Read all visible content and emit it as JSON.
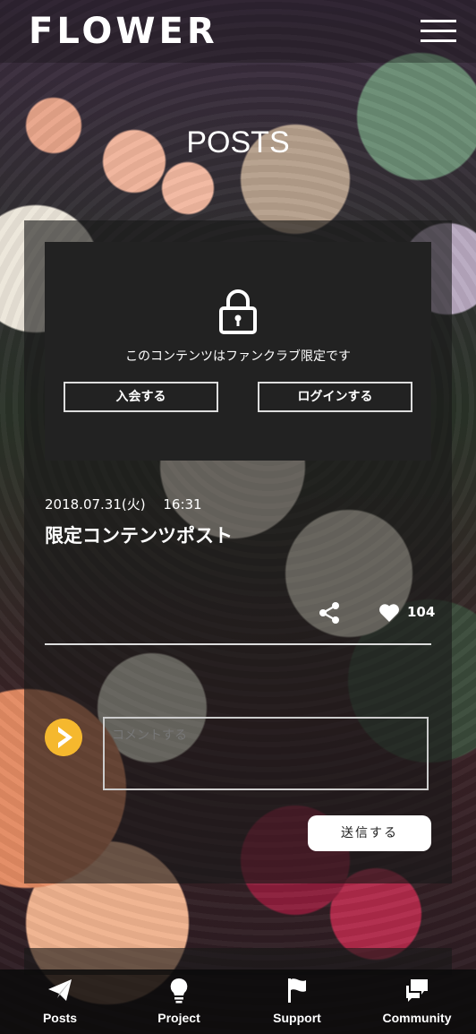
{
  "header": {
    "logo": "FLOWER",
    "menu_icon": "hamburger-icon"
  },
  "page_title": "POSTS",
  "locked": {
    "icon": "lock-icon",
    "message": "このコンテンツはファンクラブ限定です",
    "join_label": "入会する",
    "login_label": "ログインする"
  },
  "post": {
    "date": "2018.07.31(火)　 16:31",
    "title": "限定コンテンツポスト",
    "share_icon": "share-icon",
    "like_icon": "heart-icon",
    "like_count": "104"
  },
  "comment": {
    "avatar_icon": "play-avatar-icon",
    "placeholder": "コメントする",
    "value": "",
    "send_label": "送信する"
  },
  "bottom_nav": {
    "items": [
      {
        "label": "Posts",
        "icon": "paper-plane-icon"
      },
      {
        "label": "Project",
        "icon": "lightbulb-icon"
      },
      {
        "label": "Support",
        "icon": "flag-icon"
      },
      {
        "label": "Community",
        "icon": "chat-bubbles-icon"
      }
    ]
  },
  "colors": {
    "accent": "#f5b82e",
    "card": "#222222",
    "text": "#ffffff"
  }
}
